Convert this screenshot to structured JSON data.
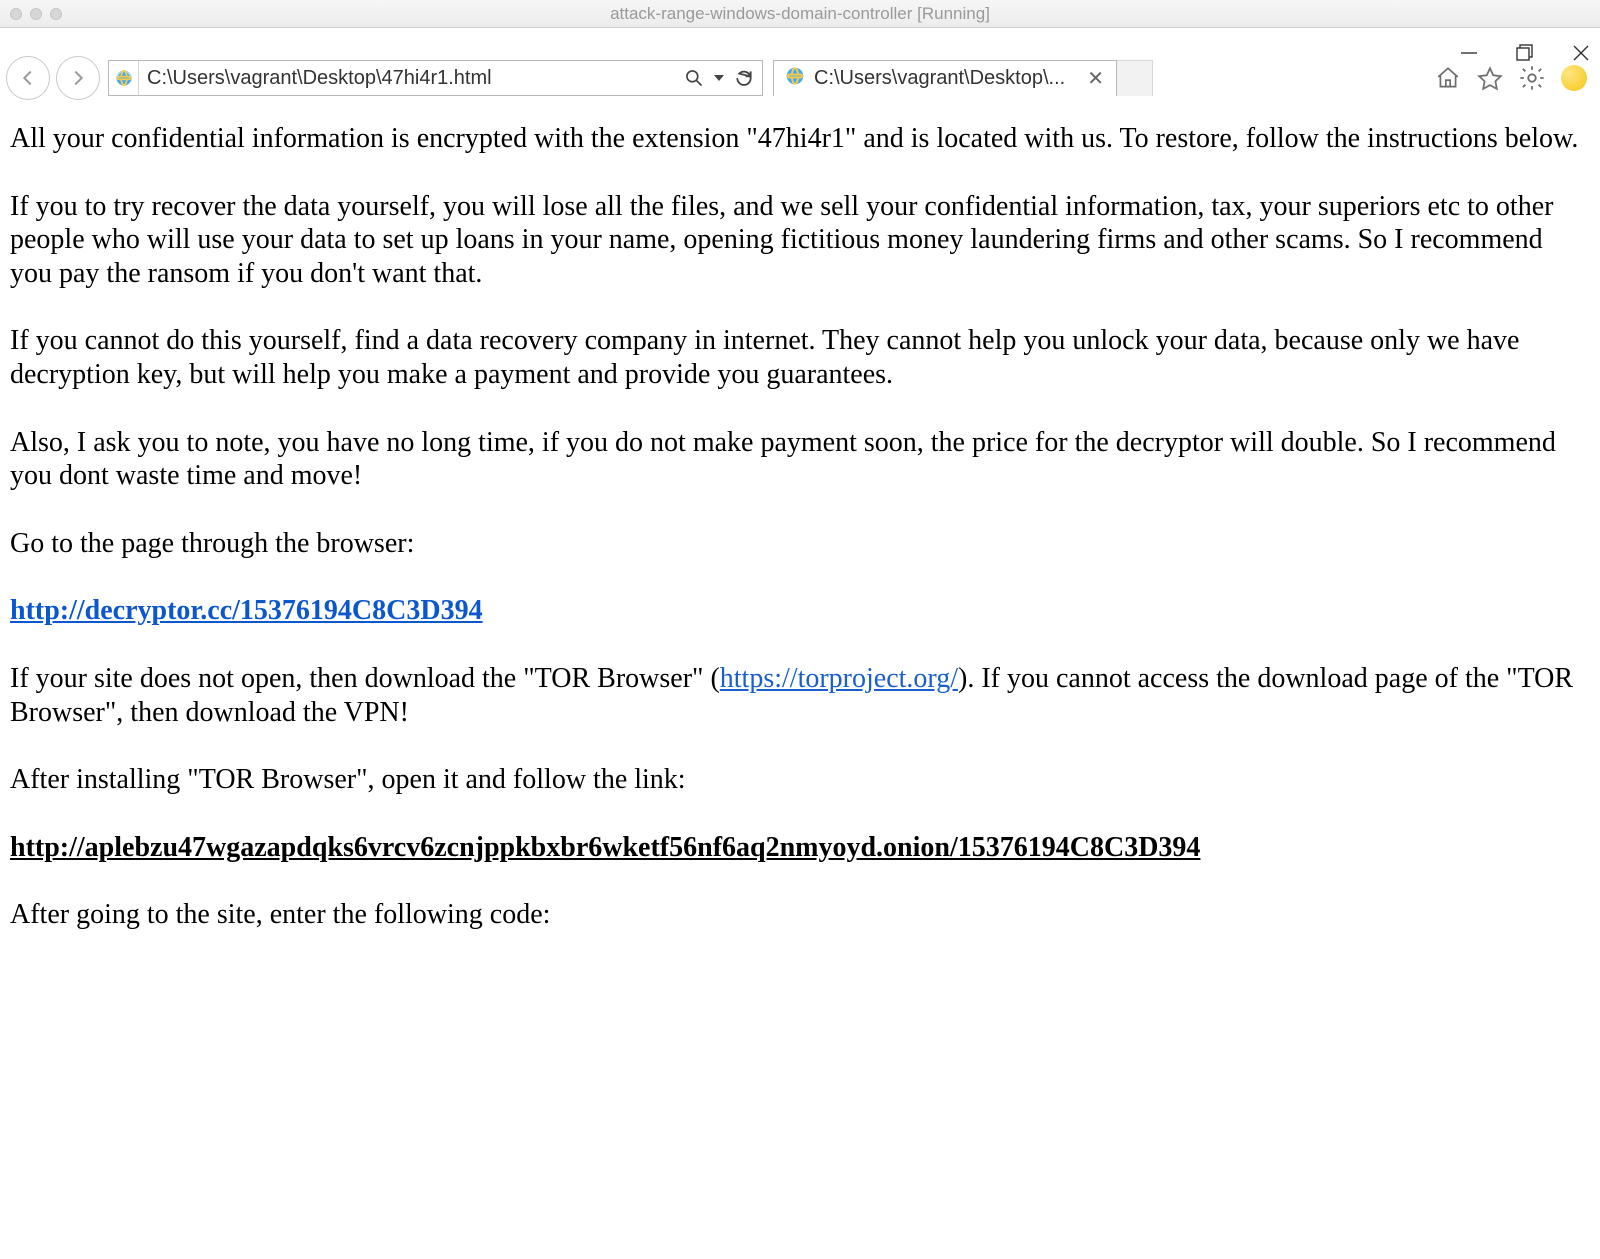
{
  "mac": {
    "title": "attack-range-windows-domain-controller [Running]"
  },
  "address_bar": {
    "url": "C:\\Users\\vagrant\\Desktop\\47hi4r1.html"
  },
  "tab": {
    "label": "C:\\Users\\vagrant\\Desktop\\..."
  },
  "page": {
    "p1": "All your confidential information is encrypted with the extension \"47hi4r1\" and is located with us. To restore, follow the instructions below.",
    "p2": "If you to try recover the data yourself, you will lose all the files, and we sell your confidential information, tax, your superiors etc to other people who will use your data to set up loans in your name, opening fictitious money laundering firms and other scams. So I recommend you pay the ransom if you don't want that.",
    "p3": "If you cannot do this yourself, find a data recovery company in internet. They cannot help you unlock your data, because only we have decryption key, but will help you make a payment and provide you guarantees.",
    "p4": "Also, I ask you to note, you have no long time, if you do not make payment soon, the price for the decryptor will double. So I recommend you dont waste time and move!",
    "p5": "Go to the page through the browser:",
    "link1": "http://decryptor.cc/15376194C8C3D394",
    "p6_pre": "If your site does not open, then download the \"TOR Browser\" (",
    "tor_link": "https://torproject.org/",
    "p6_post": "). If you cannot access the download page of the \"TOR Browser\", then download the VPN!",
    "p7": "After installing \"TOR Browser\", open it and follow the link:",
    "onion_link": "http://aplebzu47wgazapdqks6vrcv6zcnjppkbxbr6wketf56nf6aq2nmyoyd.onion/15376194C8C3D394",
    "p8": "After going to the site, enter the following code:"
  }
}
